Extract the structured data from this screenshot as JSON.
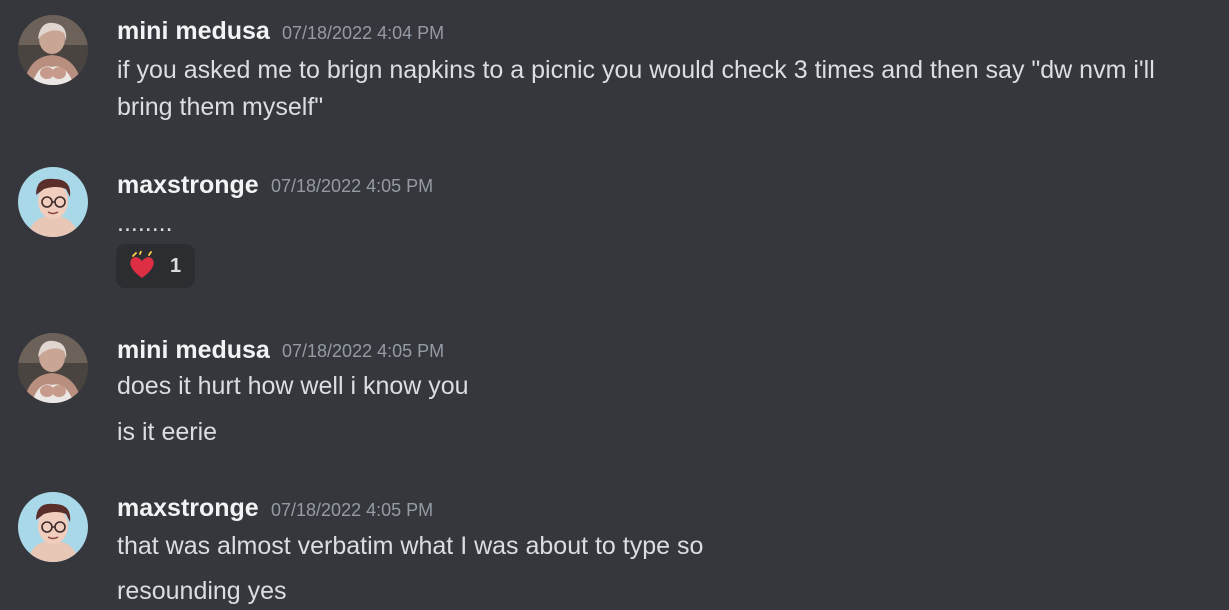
{
  "messages": [
    {
      "author": "mini medusa",
      "timestamp": "07/18/2022 4:04 PM",
      "avatar_icon": "photo-avatar-mini-medusa",
      "lines": [
        "if you asked me to brign napkins to a picnic you would check 3 times and then say \"dw nvm i'll",
        "bring them myself\""
      ]
    },
    {
      "author": "maxstronge",
      "timestamp": "07/18/2022 4:05 PM",
      "avatar_icon": "cartoon-avatar-maxstronge",
      "lines": [
        "........"
      ],
      "reaction": {
        "emoji": "heart-pulse-emoji",
        "count": "1"
      }
    },
    {
      "author": "mini medusa",
      "timestamp": "07/18/2022 4:05 PM",
      "avatar_icon": "photo-avatar-mini-medusa",
      "lines": [
        "does it hurt how  well i know you",
        "is it eerie"
      ]
    },
    {
      "author": "maxstronge",
      "timestamp": "07/18/2022 4:05 PM",
      "avatar_icon": "cartoon-avatar-maxstronge",
      "lines": [
        "that was almost verbatim what I was about to type so",
        "resounding yes"
      ]
    }
  ],
  "colors": {
    "background": "#36373d",
    "username": "#f2f3f5",
    "timestamp": "#949ba4",
    "text": "#dbdee1",
    "reaction_bg": "#2b2d31"
  }
}
